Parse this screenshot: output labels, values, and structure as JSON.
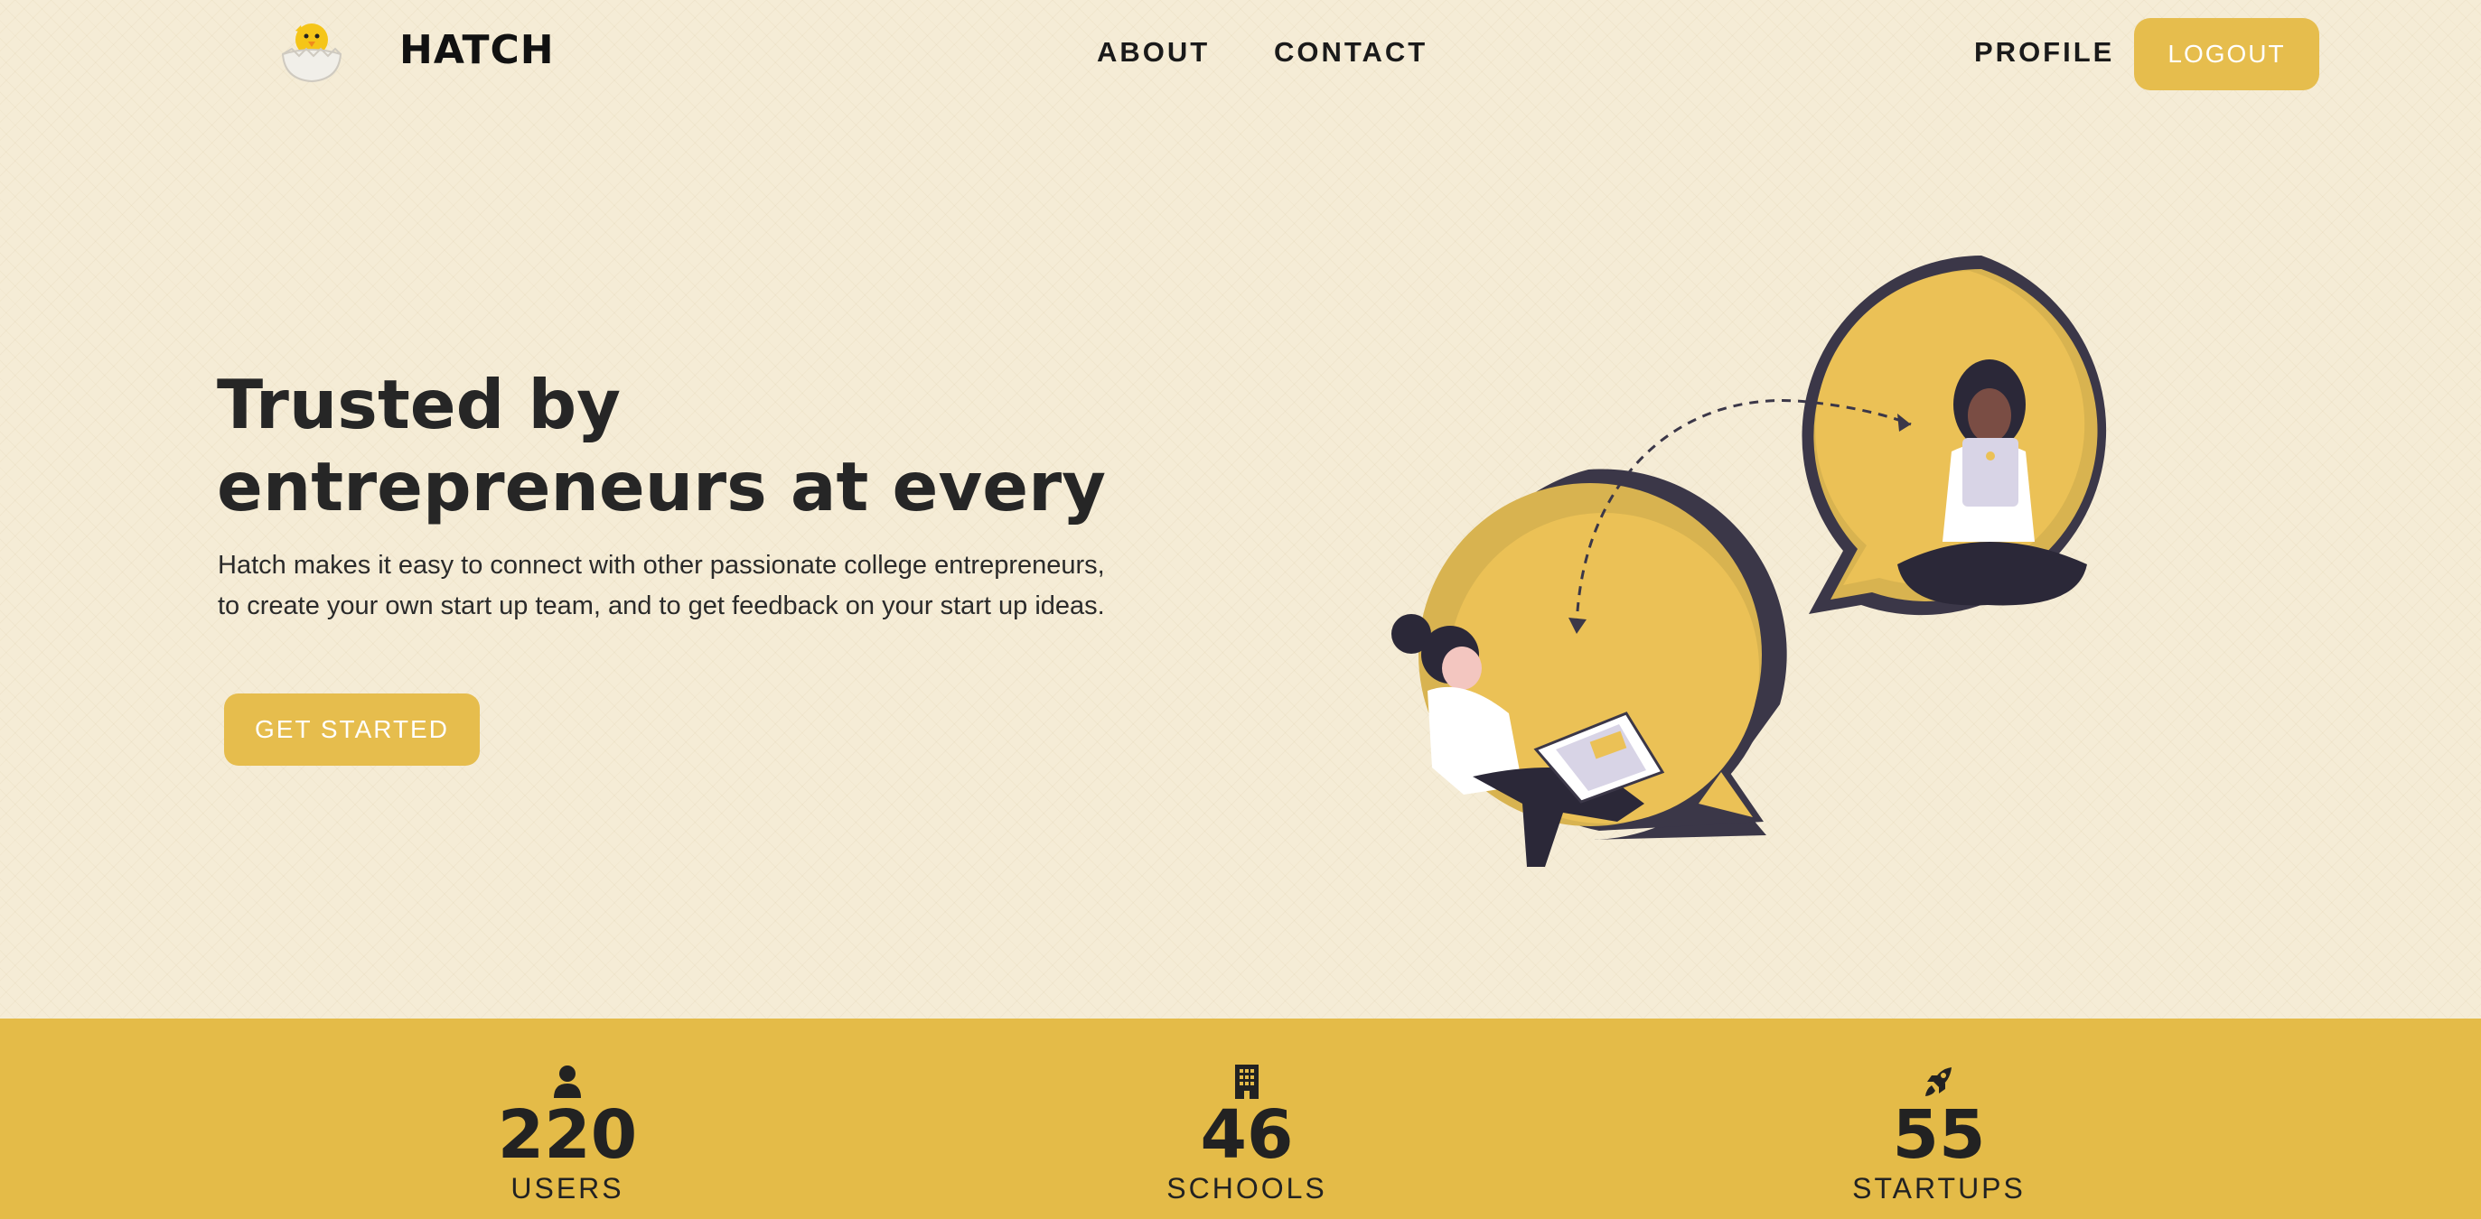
{
  "nav": {
    "logo_icon": "hatching-chick-icon",
    "brand": "HATCH",
    "links": [
      {
        "label": "ABOUT"
      },
      {
        "label": "CONTACT"
      }
    ],
    "profile": "PROFILE",
    "logout": "LOGOUT"
  },
  "hero": {
    "title": "Trusted by entrepreneurs at every",
    "description": "Hatch makes it easy to connect with other passionate college entrepreneurs, to create your own start up team, and to get feedback on your start up ideas.",
    "cta": "GET STARTED",
    "illustration": "two-people-chat-bubbles-illustration"
  },
  "stats": [
    {
      "icon": "user-icon",
      "value": "220",
      "label": "USERS"
    },
    {
      "icon": "building-icon",
      "value": "46",
      "label": "SCHOOLS"
    },
    {
      "icon": "rocket-icon",
      "value": "55",
      "label": "STARTUPS"
    }
  ],
  "colors": {
    "accent": "#e6bd4d",
    "stats_band": "#e4bb48",
    "background": "#f5ecd6",
    "dark": "#3b3748",
    "text": "#222222"
  }
}
